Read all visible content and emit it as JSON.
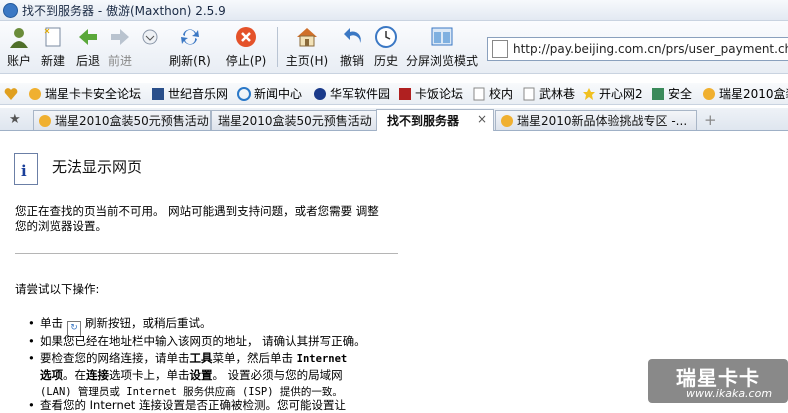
{
  "window": {
    "title": "找不到服务器 - 傲游(Maxthon) 2.5.9"
  },
  "toolbar": {
    "buttons": [
      {
        "label": "账户",
        "icon": "user-icon"
      },
      {
        "label": "新建",
        "icon": "new-page-icon"
      },
      {
        "label": "后退",
        "icon": "back-arrow-icon"
      },
      {
        "label": "前进",
        "icon": "forward-arrow-icon"
      },
      {
        "label": "刷新(R)",
        "icon": "refresh-icon"
      },
      {
        "label": "停止(P)",
        "icon": "stop-icon"
      },
      {
        "label": "主页(H)",
        "icon": "home-icon"
      },
      {
        "label": "撤销",
        "icon": "undo-icon"
      },
      {
        "label": "历史",
        "icon": "clock-icon"
      },
      {
        "label": "分屏浏览模式",
        "icon": "split-screen-icon"
      }
    ]
  },
  "address": {
    "value": "http://pay.beijing.com.cn/prs/user_payment.check"
  },
  "favorites": [
    "瑞星卡卡安全论坛",
    "世纪音乐网",
    "新闻中心",
    "华军软件园",
    "卡饭论坛",
    "校内",
    "武林巷",
    "开心网2",
    "安全",
    "瑞星2010盒装"
  ],
  "tabs": [
    {
      "label": "瑞星2010盒装50元预售活动",
      "active": false
    },
    {
      "label": "瑞星2010盒装50元预售活动",
      "active": false
    },
    {
      "label": "找不到服务器",
      "active": true
    },
    {
      "label": "瑞星2010新品体验挑战专区 -...",
      "active": false
    }
  ],
  "page": {
    "heading": "无法显示网页",
    "para1_line1": "您正在查找的页当前不可用。 网站可能遇到支持问题，或者您需要 调整",
    "para1_line2": "您的浏览器设置。",
    "try_label": "请尝试以下操作:",
    "b1_pre": "单击",
    "b1_post": "刷新按钮，或稍后重试。",
    "b2": "如果您已经在地址栏中输入该网页的地址， 请确认其拼写正确。",
    "b3_l1a": "要检查您的网络连接，请单击",
    "b3_bold1": "工具",
    "b3_l1b": "菜单，然后单击",
    "b3_internet": "Internet",
    "b3_bold2": "选项",
    "b3_l2a": "。在",
    "b3_bold3": "连接",
    "b3_l2b": "选项卡上，单击",
    "b3_bold4": "设置",
    "b3_l2c": "。 设置必须与您的局域网",
    "b3_l3": "(LAN) 管理员或 Internet 服务供应商 (ISP) 提供的一致。",
    "b4": "查看您的 Internet 连接设置是否正确被检测。您可能设置让"
  },
  "watermark": {
    "title": "瑞星卡卡",
    "url": "www.ikaka.com"
  },
  "colors": {
    "accent": "#3b78c4",
    "tab_border": "#a9b6c7"
  }
}
